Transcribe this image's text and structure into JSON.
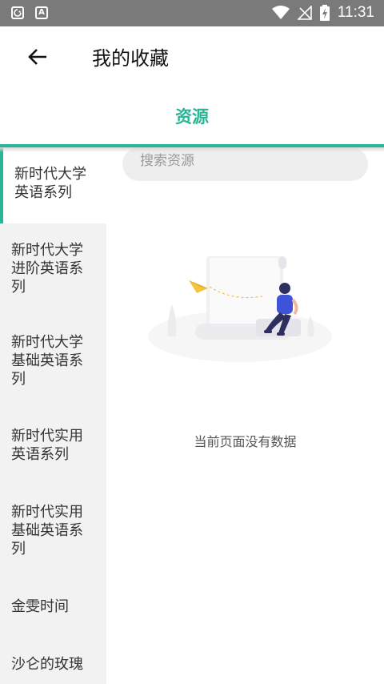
{
  "status_bar": {
    "time": "11:31",
    "icons": [
      "cloud-sync-icon",
      "font-a-icon",
      "wifi-icon",
      "no-signal-icon",
      "battery-charging-icon"
    ]
  },
  "header": {
    "title": "我的收藏",
    "back_icon": "arrow-left-icon"
  },
  "tabs": [
    {
      "label": "资源",
      "active": true
    }
  ],
  "accent_color": "#2bb597",
  "sidebar": {
    "items": [
      {
        "label": "新时代大学英语系列",
        "active": true
      },
      {
        "label": "新时代大学进阶英语系列",
        "active": false
      },
      {
        "label": "新时代大学基础英语系列",
        "active": false
      },
      {
        "label": "新时代实用英语系列",
        "active": false
      },
      {
        "label": "新时代实用基础英语系列",
        "active": false
      },
      {
        "label": "金雯时间",
        "active": false
      },
      {
        "label": "沙仑的玫瑰",
        "active": false
      }
    ]
  },
  "search": {
    "placeholder": "搜索资源"
  },
  "empty_state": {
    "message": "当前页面没有数据"
  }
}
